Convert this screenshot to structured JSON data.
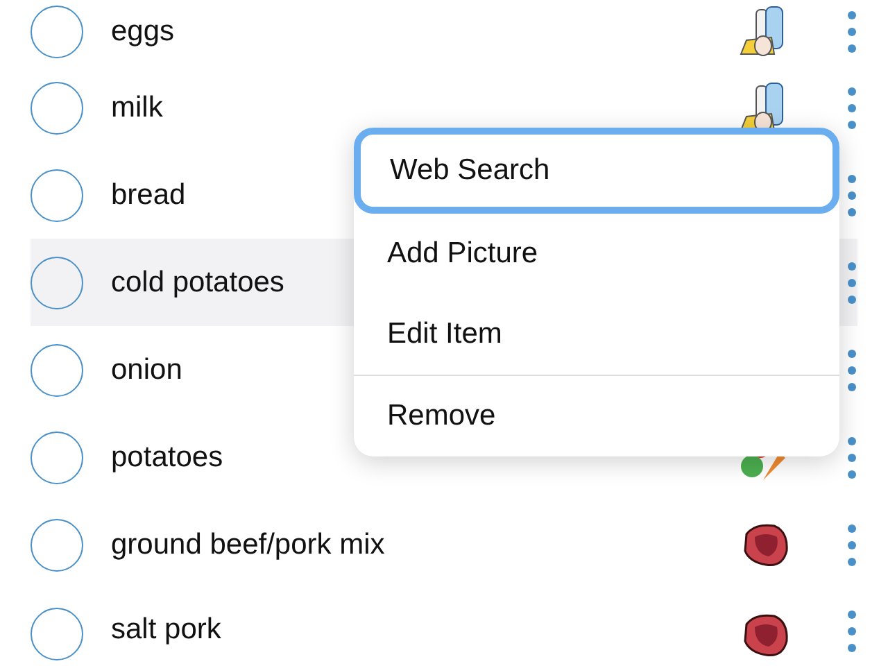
{
  "items": [
    {
      "label": "eggs",
      "checked": false,
      "selected": false,
      "kind": "dairy"
    },
    {
      "label": "milk",
      "checked": false,
      "selected": false,
      "kind": "dairy"
    },
    {
      "label": "bread",
      "checked": false,
      "selected": false
    },
    {
      "label": "cold potatoes",
      "checked": false,
      "selected": true
    },
    {
      "label": "onion",
      "checked": false,
      "selected": false
    },
    {
      "label": "potatoes",
      "checked": false,
      "selected": false,
      "kind": "vegetables"
    },
    {
      "label": "ground beef/pork mix",
      "checked": false,
      "selected": false,
      "kind": "meat"
    },
    {
      "label": "salt pork",
      "checked": false,
      "selected": false,
      "kind": "meat"
    }
  ],
  "context_menu": {
    "groups": [
      [
        {
          "label": "Web Search",
          "focused": true
        },
        {
          "label": "Add Picture",
          "focused": false
        },
        {
          "label": "Edit Item",
          "focused": false
        }
      ],
      [
        {
          "label": "Remove",
          "focused": false
        }
      ]
    ]
  }
}
